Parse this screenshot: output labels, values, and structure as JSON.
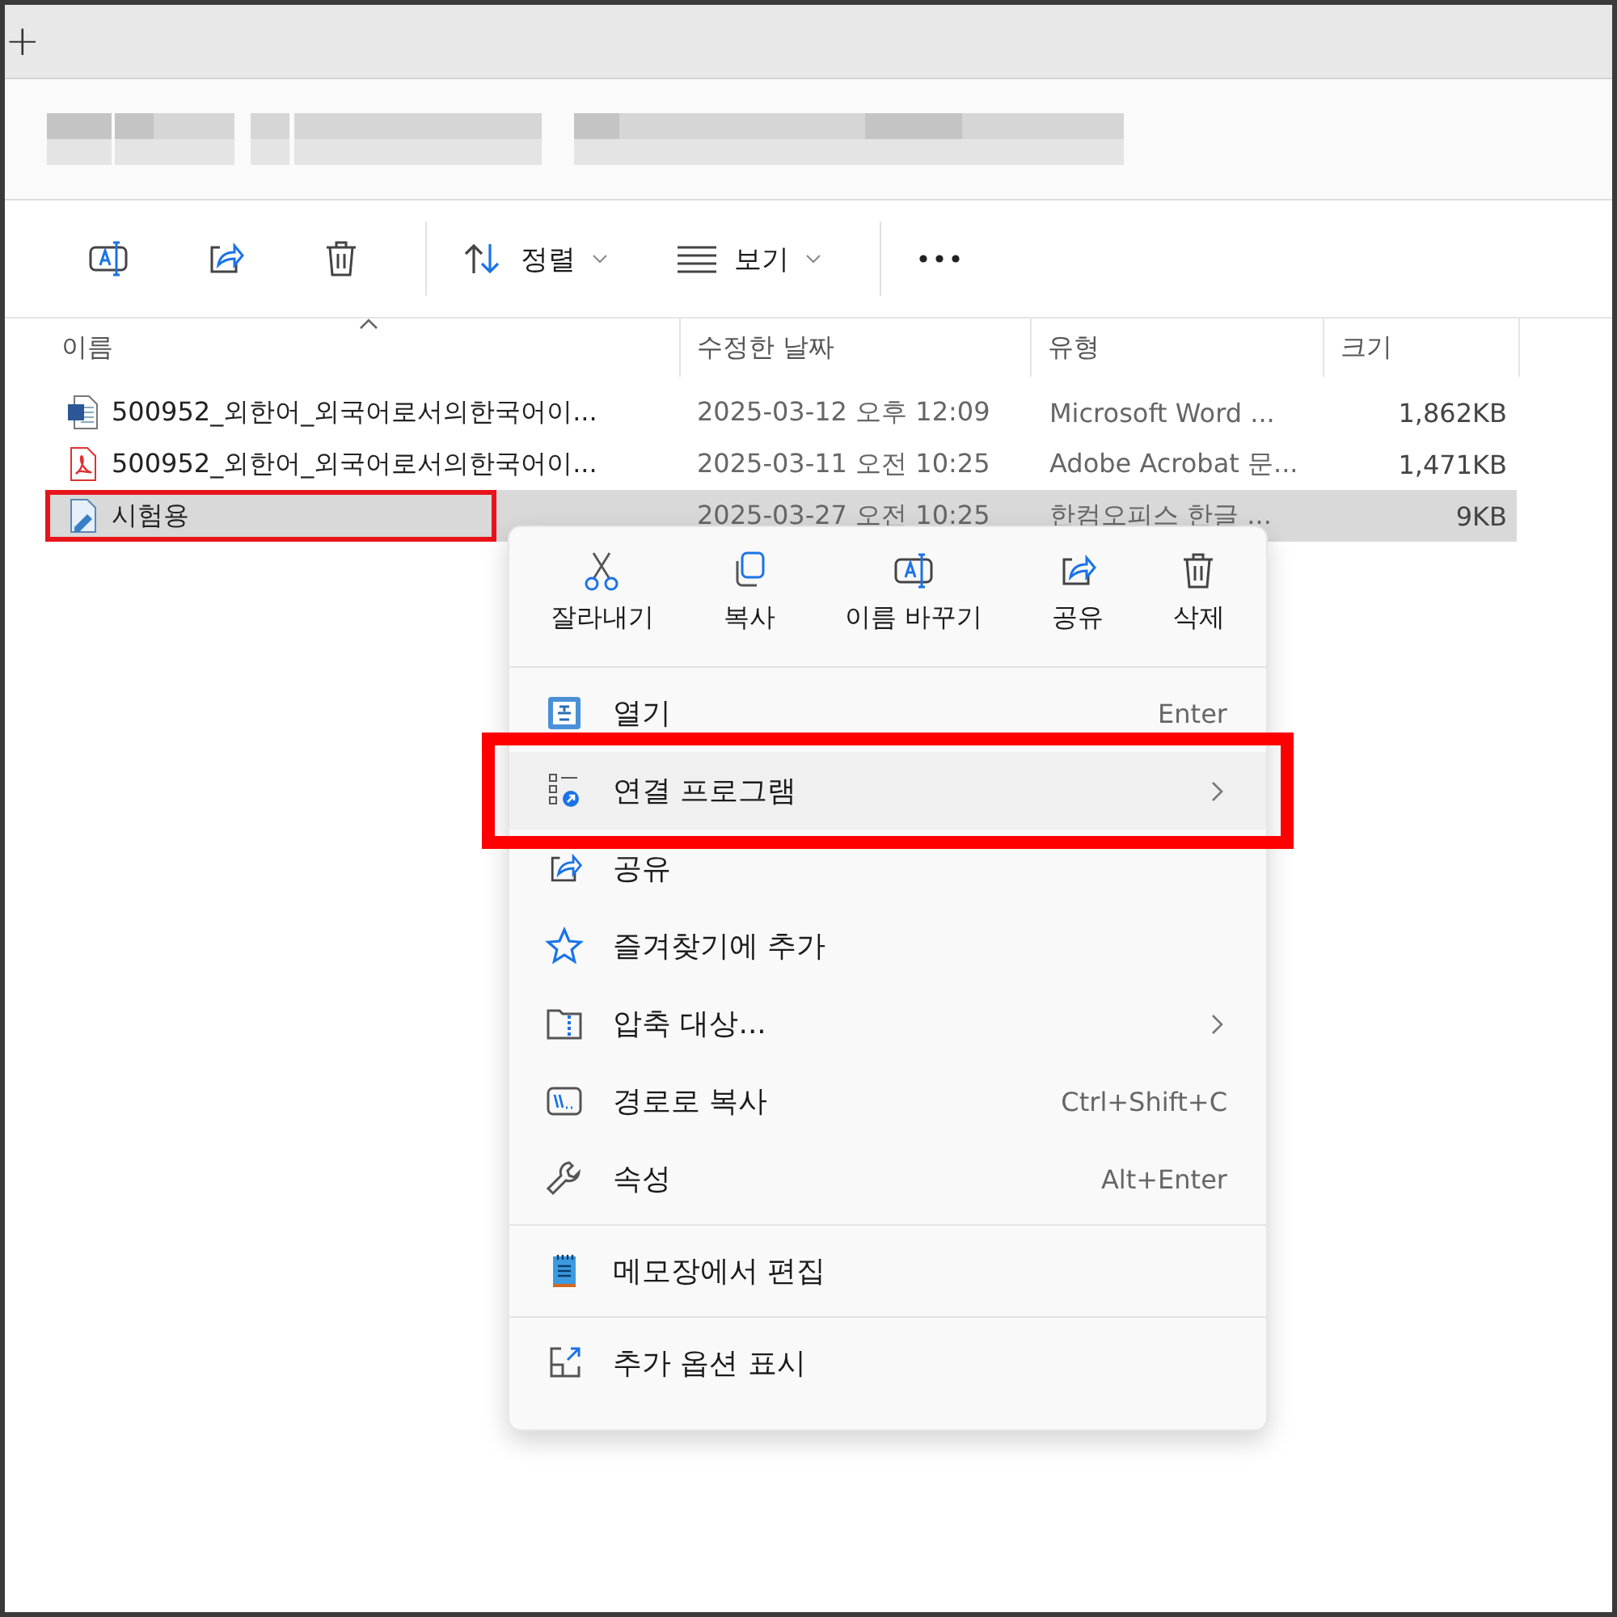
{
  "tab_strip": {
    "new_tab": "+"
  },
  "toolbar": {
    "actions": [
      {
        "kind": "rename"
      },
      {
        "kind": "share"
      },
      {
        "kind": "delete"
      }
    ],
    "sort": {
      "label": "정렬"
    },
    "view": {
      "label": "보기"
    }
  },
  "file_list": {
    "columns": [
      "이름",
      "수정한 날짜",
      "유형",
      "크기"
    ],
    "rows": [
      {
        "kind": "word",
        "name": "500952_외한어_외국어로서의한국어이...",
        "date": "2025-03-12 오후 12:09",
        "type": "Microsoft Word ...",
        "size": "1,862KB",
        "selected": false,
        "annotated": false
      },
      {
        "kind": "pdf",
        "name": "500952_외한어_외국어로서의한국어이...",
        "date": "2025-03-11 오전 10:25",
        "type": "Adobe Acrobat 문...",
        "size": "1,471KB",
        "selected": false,
        "annotated": false
      },
      {
        "kind": "hwp",
        "name": "시험용",
        "date": "2025-03-27 오전 10:25",
        "type": "한컴오피스 한글 ...",
        "size": "9KB",
        "selected": true,
        "annotated": true
      }
    ]
  },
  "context_menu": {
    "quick_actions": [
      {
        "kind": "cut",
        "label": "잘라내기"
      },
      {
        "kind": "copy",
        "label": "복사"
      },
      {
        "kind": "rename",
        "label": "이름 바꾸기"
      },
      {
        "kind": "share",
        "label": "공유"
      },
      {
        "kind": "delete",
        "label": "삭제"
      }
    ],
    "sections": [
      [
        {
          "kind": "open",
          "label": "열기",
          "shortcut": "Enter",
          "submenu": false,
          "annotated": false
        },
        {
          "kind": "openwith",
          "label": "연결 프로그램",
          "submenu": true,
          "annotated": true
        },
        {
          "kind": "share",
          "label": "공유",
          "submenu": false,
          "annotated": false
        },
        {
          "kind": "star",
          "label": "즐겨찾기에 추가",
          "submenu": false,
          "annotated": false
        },
        {
          "kind": "zip",
          "label": "압축 대상...",
          "submenu": true,
          "annotated": false
        },
        {
          "kind": "path",
          "label": "경로로 복사",
          "shortcut": "Ctrl+Shift+C",
          "submenu": false,
          "annotated": false
        },
        {
          "kind": "wrench",
          "label": "속성",
          "shortcut": "Alt+Enter",
          "submenu": false,
          "annotated": false
        }
      ],
      [
        {
          "kind": "notepad",
          "label": "메모장에서 편집",
          "submenu": false,
          "annotated": false
        }
      ],
      [
        {
          "kind": "more",
          "label": "추가 옵션 표시",
          "submenu": false,
          "annotated": false
        }
      ]
    ]
  }
}
